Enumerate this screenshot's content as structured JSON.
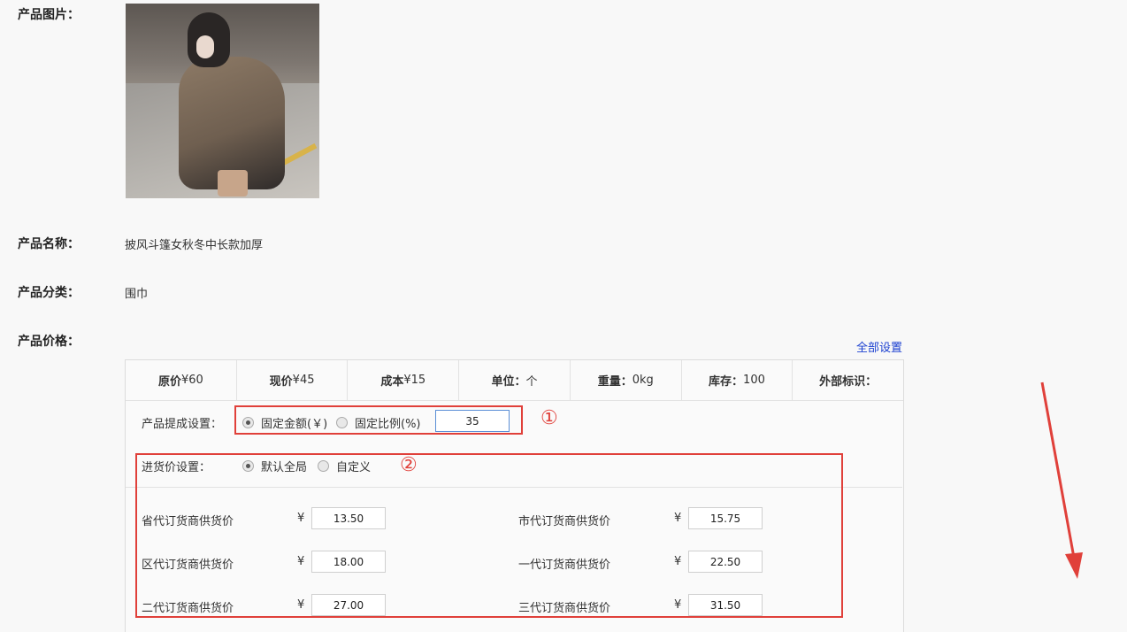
{
  "labels": {
    "image": "产品图片：",
    "name": "产品名称：",
    "category": "产品分类：",
    "price": "产品价格："
  },
  "product": {
    "name": "披风斗篷女秋冬中长款加厚",
    "category": "围巾"
  },
  "set_all_link": "全部设置",
  "price_header": [
    {
      "label": "原价",
      "value": "¥60"
    },
    {
      "label": "现价",
      "value": "¥45"
    },
    {
      "label": "成本",
      "value": "¥15"
    },
    {
      "label": "单位：",
      "value": "个"
    },
    {
      "label": "重量：",
      "value": "0kg"
    },
    {
      "label": "库存：",
      "value": "100"
    },
    {
      "label": "外部标识：",
      "value": ""
    }
  ],
  "commission": {
    "label": "产品提成设置：",
    "option_fixed": "固定金额(￥)",
    "option_ratio": "固定比例(%)",
    "value": "35"
  },
  "purchase": {
    "label": "进货价设置：",
    "option_default": "默认全局",
    "option_custom": "自定义"
  },
  "currency_symbol": "¥",
  "suppliers": [
    {
      "label": "省代订货商供货价",
      "price": "13.50"
    },
    {
      "label": "市代订货商供货价",
      "price": "15.75"
    },
    {
      "label": "区代订货商供货价",
      "price": "18.00"
    },
    {
      "label": "一代订货商供货价",
      "price": "22.50"
    },
    {
      "label": "二代订货商供货价",
      "price": "27.00"
    },
    {
      "label": "三代订货商供货价",
      "price": "31.50"
    }
  ],
  "annotations": {
    "one": "①",
    "two": "②"
  },
  "colors": {
    "annotation": "#e0403a",
    "link": "#1a3fd0"
  }
}
